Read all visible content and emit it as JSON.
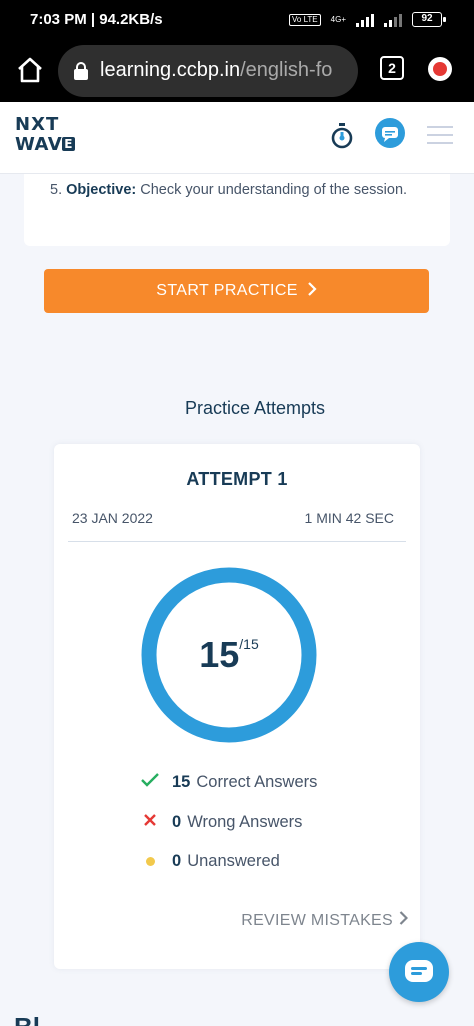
{
  "status_bar": {
    "left_text": "7:03 PM | 94.2KB/s",
    "volte": "Vo LTE",
    "network": "4G+",
    "battery": "92"
  },
  "browser": {
    "url_host": "learning.ccbp.in",
    "url_path": "/english-fo",
    "tab_count": "2"
  },
  "app_header": {
    "logo_line1": "NXT",
    "logo_line2": "WAV",
    "logo_badge": "E"
  },
  "objective": {
    "number": "5.",
    "label": "Objective:",
    "text": "Check your understanding of the session."
  },
  "start_button": {
    "label": "START PRACTICE"
  },
  "practice_attempts": {
    "title": "Practice Attempts",
    "attempt": {
      "title": "ATTEMPT 1",
      "date": "23 JAN 2022",
      "duration": "1 MIN 42 SEC",
      "score": "15",
      "total": "/15",
      "stats": {
        "correct_count": "15",
        "correct_label": "Correct Answers",
        "wrong_count": "0",
        "wrong_label": "Wrong Answers",
        "unanswered_count": "0",
        "unanswered_label": "Unanswered"
      },
      "review_label": "REVIEW MISTAKES"
    }
  },
  "next_section": {
    "title": "Bl"
  },
  "colors": {
    "brand_navy": "#183b56",
    "accent_orange": "#f7892b",
    "ring_blue": "#2d9cdb",
    "correct_green": "#27ae60",
    "wrong_red": "#e53935",
    "unanswered_yellow": "#f2c94c"
  }
}
